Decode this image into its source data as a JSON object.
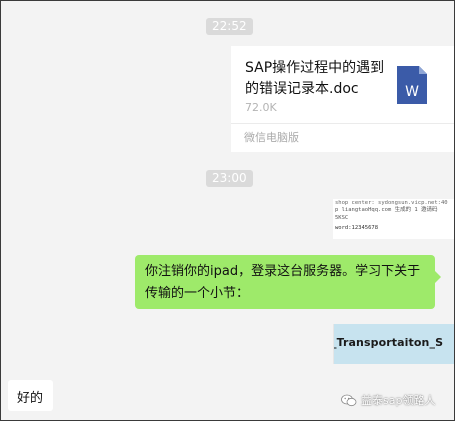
{
  "chat": {
    "timestamps": [
      "22:52",
      "23:00"
    ],
    "file_message": {
      "file_name": "SAP操作过程中的遇到的错误记录本.doc",
      "file_size": "72.0K",
      "source": "微信电脑版",
      "file_icon": "word-doc-icon",
      "icon_letter": "W",
      "icon_color": "#3b5ba8"
    },
    "screenshot_message": {
      "lines": [
        "shop center: sydongsun.vicp.net:40",
        "p liangtaoHqq.com 生成的 1 邀请码",
        "5KSC",
        "word:12345678"
      ]
    },
    "sent_text": "你注销你的ipad，登录这台服务器。学习下关于传输的一个小节：",
    "sent_bubble_color": "#9eea6a",
    "image_message_text": "_Transportaiton_S",
    "received_text": "好的"
  },
  "watermark": {
    "icon": "wechat-icon",
    "text": "益泰sap领路人"
  }
}
